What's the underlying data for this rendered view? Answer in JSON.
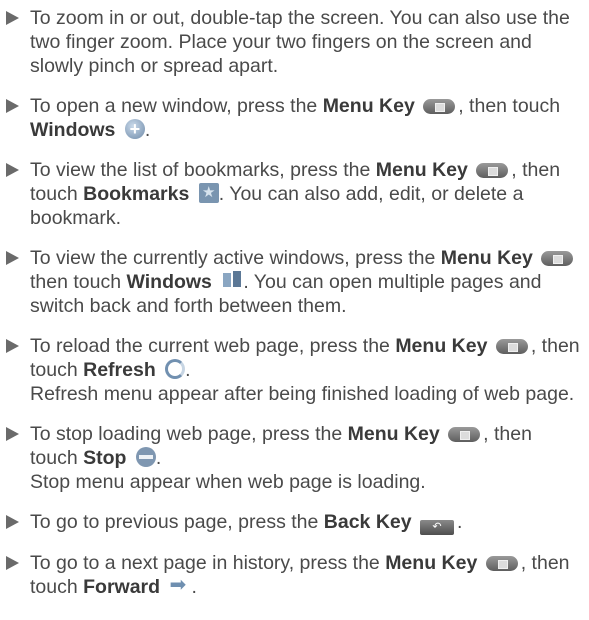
{
  "items": [
    {
      "t1": "To zoom in or out, double-tap the screen. You can also use the two finger zoom. Place your two fingers on the screen and slowly pinch or spread apart."
    },
    {
      "t1": "To open a new window, press the ",
      "k1": "Menu Key",
      "t2": ", then touch ",
      "k2": "Windows",
      "t3": "."
    },
    {
      "t1": "To view the list of bookmarks, press the ",
      "k1": "Menu Key",
      "t2": ", then touch ",
      "k2": "Bookmarks",
      "t3": ". You can also add, edit, or delete a bookmark."
    },
    {
      "t1": "To view the currently active windows, press the ",
      "k1": "Menu Key",
      "t2": " then touch ",
      "k2": "Windows",
      "t3": ". You can open multiple pages and switch back and forth between them."
    },
    {
      "t1": "To reload the current web page, press the ",
      "k1": "Menu Key",
      "t2": ", then touch ",
      "k2": "Refresh",
      "t3": ".",
      "t4": "Refresh menu appear after being finished loading of web page."
    },
    {
      "t1": "To stop loading web page, press the ",
      "k1": "Menu Key",
      "t2": ", then touch ",
      "k2": "Stop",
      "t3": ".",
      "t4": "Stop menu appear when web page is loading."
    },
    {
      "t1": "To go to previous page, press the ",
      "k1": "Back Key",
      "t2": "."
    },
    {
      "t1": "To go to a next page in history, press the ",
      "k1": "Menu Key",
      "t2": ", then touch ",
      "k2": "Forward",
      "t3": "."
    }
  ],
  "icons": {
    "menu_key": "menu-key-icon",
    "back_key": "back-key-icon",
    "windows": "plus-circle-icon",
    "bookmarks": "bookmark-star-icon",
    "windows_list": "multiple-windows-icon",
    "refresh": "refresh-icon",
    "stop": "stop-icon",
    "forward": "forward-arrow-icon"
  },
  "colors": {
    "text": "#4a4a4a",
    "icon_blue": "#7190b0"
  }
}
